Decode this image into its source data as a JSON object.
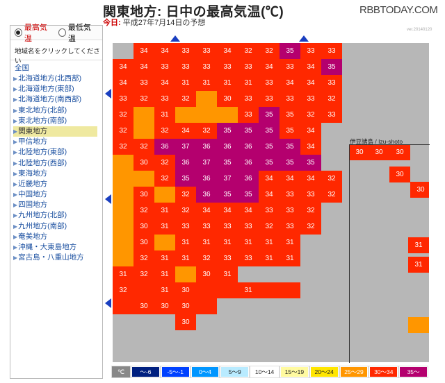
{
  "header": {
    "title": "関東地方: 日中の最高気温(℃)",
    "today_label": "今日:",
    "forecast_date": "平成27年7月14日の予想",
    "brand": "RBBTODAY.COM",
    "version": "ver.20140120"
  },
  "sidebar": {
    "radio_max": "最高気温",
    "radio_min": "最低気温",
    "instruction": "地域名をクリックしてください",
    "all_label": "全国",
    "items": [
      {
        "label": "北海道地方(北西部)"
      },
      {
        "label": "北海道地方(東部)"
      },
      {
        "label": "北海道地方(南西部)"
      },
      {
        "label": "東北地方(北部)"
      },
      {
        "label": "東北地方(南部)"
      },
      {
        "label": "関東地方"
      },
      {
        "label": "甲信地方"
      },
      {
        "label": "北陸地方(東部)"
      },
      {
        "label": "北陸地方(西部)"
      },
      {
        "label": "東海地方"
      },
      {
        "label": "近畿地方"
      },
      {
        "label": "中国地方"
      },
      {
        "label": "四国地方"
      },
      {
        "label": "九州地方(北部)"
      },
      {
        "label": "九州地方(南部)"
      },
      {
        "label": "奄美地方"
      },
      {
        "label": "沖縄・大東島地方"
      },
      {
        "label": "宮古島・八重山地方"
      }
    ],
    "selected_index": 5
  },
  "map": {
    "izu_label": "伊豆諸島 / Izu-shoto",
    "colors": {
      "c": "#ff2800",
      "v": "#b4006e",
      "o": "#ff9600"
    },
    "cells": [
      [
        "t,1",
        "34c"
      ],
      [
        "t,2",
        "34c"
      ],
      [
        "t,3",
        "33c"
      ],
      [
        "t,4",
        "33c"
      ],
      [
        "t,5",
        "34c"
      ],
      [
        "t,6",
        "32c"
      ],
      [
        "t,7",
        "32c"
      ],
      [
        "t,8",
        "35v"
      ],
      [
        "t,9",
        "33c"
      ],
      [
        "t,10",
        "33c"
      ],
      [
        "0,0",
        "34c"
      ],
      [
        "0,1",
        "34c"
      ],
      [
        "0,2",
        "33c"
      ],
      [
        "0,3",
        "33c"
      ],
      [
        "0,4",
        "33c"
      ],
      [
        "0,5",
        "33c"
      ],
      [
        "0,6",
        "33c"
      ],
      [
        "0,7",
        "34c"
      ],
      [
        "0,8",
        "33c"
      ],
      [
        "0,9",
        "34c"
      ],
      [
        "0,10",
        "35v"
      ],
      [
        "1,0",
        "34c"
      ],
      [
        "1,1",
        "33c"
      ],
      [
        "1,2",
        "34c"
      ],
      [
        "1,3",
        "31c"
      ],
      [
        "1,4",
        "31c"
      ],
      [
        "1,5",
        "31c"
      ],
      [
        "1,6",
        "31c"
      ],
      [
        "1,7",
        "33c"
      ],
      [
        "1,8",
        "34c"
      ],
      [
        "1,9",
        "34c"
      ],
      [
        "1,10",
        "33c"
      ],
      [
        "2,0",
        "33c"
      ],
      [
        "2,1",
        "32c"
      ],
      [
        "2,2",
        "33c"
      ],
      [
        "2,3",
        "32c"
      ],
      [
        "2,4",
        "o"
      ],
      [
        "2,5",
        "30c"
      ],
      [
        "2,6",
        "33c"
      ],
      [
        "2,7",
        "33c"
      ],
      [
        "2,8",
        "33c"
      ],
      [
        "2,9",
        "33c"
      ],
      [
        "2,10",
        "32c"
      ],
      [
        "3,0",
        "32c"
      ],
      [
        "3,1",
        "o"
      ],
      [
        "3,2",
        "31c"
      ],
      [
        "3,3",
        "o"
      ],
      [
        "3,4",
        "o"
      ],
      [
        "3,5",
        "o"
      ],
      [
        "3,6",
        "33c"
      ],
      [
        "3,7",
        "35v"
      ],
      [
        "3,8",
        "35c"
      ],
      [
        "3,9",
        "32c"
      ],
      [
        "3,10",
        "33c"
      ],
      [
        "4,0",
        "32c"
      ],
      [
        "4,1",
        "o"
      ],
      [
        "4,2",
        "32c"
      ],
      [
        "4,3",
        "34c"
      ],
      [
        "4,4",
        "32c"
      ],
      [
        "4,5",
        "35v"
      ],
      [
        "4,6",
        "35v"
      ],
      [
        "4,7",
        "35v"
      ],
      [
        "4,8",
        "35c"
      ],
      [
        "4,9",
        "34c"
      ],
      [
        "5,0",
        "32c"
      ],
      [
        "5,1",
        "32c"
      ],
      [
        "5,2",
        "36v"
      ],
      [
        "5,3",
        "37v"
      ],
      [
        "5,4",
        "36v"
      ],
      [
        "5,5",
        "36v"
      ],
      [
        "5,6",
        "36v"
      ],
      [
        "5,7",
        "35v"
      ],
      [
        "5,8",
        "35v"
      ],
      [
        "5,9",
        "34c"
      ],
      [
        "6,0",
        "o"
      ],
      [
        "6,1",
        "30c"
      ],
      [
        "6,2",
        "32c"
      ],
      [
        "6,3",
        "36v"
      ],
      [
        "6,4",
        "37v"
      ],
      [
        "6,5",
        "35v"
      ],
      [
        "6,6",
        "36v"
      ],
      [
        "6,7",
        "35v"
      ],
      [
        "6,8",
        "35v"
      ],
      [
        "6,9",
        "35v"
      ],
      [
        "7,0",
        "o"
      ],
      [
        "7,1",
        "o"
      ],
      [
        "7,2",
        "32c"
      ],
      [
        "7,3",
        "35v"
      ],
      [
        "7,4",
        "36v"
      ],
      [
        "7,5",
        "37v"
      ],
      [
        "7,6",
        "36v"
      ],
      [
        "7,7",
        "34c"
      ],
      [
        "7,8",
        "34c"
      ],
      [
        "7,9",
        "34c"
      ],
      [
        "7,10",
        "32c"
      ],
      [
        "8,0",
        "o"
      ],
      [
        "8,1",
        "30c"
      ],
      [
        "8,2",
        "o"
      ],
      [
        "8,3",
        "32c"
      ],
      [
        "8,4",
        "36v"
      ],
      [
        "8,5",
        "35v"
      ],
      [
        "8,6",
        "35v"
      ],
      [
        "8,7",
        "34c"
      ],
      [
        "8,8",
        "33c"
      ],
      [
        "8,9",
        "33c"
      ],
      [
        "8,10",
        "32c"
      ],
      [
        "9,0",
        "o"
      ],
      [
        "9,1",
        "32c"
      ],
      [
        "9,2",
        "31c"
      ],
      [
        "9,3",
        "32c"
      ],
      [
        "9,4",
        "34c"
      ],
      [
        "9,5",
        "34c"
      ],
      [
        "9,6",
        "34c"
      ],
      [
        "9,7",
        "33c"
      ],
      [
        "9,8",
        "33c"
      ],
      [
        "9,9",
        "32c"
      ],
      [
        "10,0",
        "o"
      ],
      [
        "10,1",
        "30c"
      ],
      [
        "10,2",
        "31c"
      ],
      [
        "10,3",
        "33c"
      ],
      [
        "10,4",
        "33c"
      ],
      [
        "10,5",
        "33c"
      ],
      [
        "10,6",
        "33c"
      ],
      [
        "10,7",
        "32c"
      ],
      [
        "10,8",
        "33c"
      ],
      [
        "10,9",
        "32c"
      ],
      [
        "11,0",
        "o"
      ],
      [
        "11,1",
        "30c"
      ],
      [
        "11,2",
        "o"
      ],
      [
        "11,3",
        "31c"
      ],
      [
        "11,4",
        "31c"
      ],
      [
        "11,5",
        "31c"
      ],
      [
        "11,6",
        "31c"
      ],
      [
        "11,7",
        "31c"
      ],
      [
        "11,8",
        "31c"
      ],
      [
        "12,0",
        "o"
      ],
      [
        "12,1",
        "32c"
      ],
      [
        "12,2",
        "31c"
      ],
      [
        "12,3",
        "31c"
      ],
      [
        "12,4",
        "32c"
      ],
      [
        "12,5",
        "33c"
      ],
      [
        "12,6",
        "33c"
      ],
      [
        "12,7",
        "31c"
      ],
      [
        "12,8",
        "31c"
      ],
      [
        "13,0",
        "31c"
      ],
      [
        "13,1",
        "32c"
      ],
      [
        "13,2",
        "31c"
      ],
      [
        "13,3",
        "o"
      ],
      [
        "13,4",
        "30c"
      ],
      [
        "13,5",
        "31c"
      ],
      [
        "14,0",
        "32c"
      ],
      [
        "14,1",
        "c"
      ],
      [
        "14,2",
        "31c"
      ],
      [
        "14,3",
        "30c"
      ],
      [
        "14,4",
        "c"
      ],
      [
        "14,5",
        "c"
      ],
      [
        "14,6",
        "31c"
      ],
      [
        "14,7",
        "c"
      ],
      [
        "14,8",
        "c"
      ],
      [
        "15,0",
        "c"
      ],
      [
        "15,1",
        "30c"
      ],
      [
        "15,2",
        "30c"
      ],
      [
        "15,3",
        "30c"
      ],
      [
        "15,4",
        "c"
      ],
      [
        "16,3",
        "30c"
      ],
      [
        "i,0",
        "30c"
      ],
      [
        "i,1",
        "30c"
      ],
      [
        "i,2",
        "30c"
      ],
      [
        "j,0",
        "30c"
      ],
      [
        "j,1",
        "30c"
      ],
      [
        "k,0",
        "31c"
      ],
      [
        "k2,0",
        "31c"
      ],
      [
        "m,0",
        "o"
      ]
    ]
  },
  "legend": {
    "unit": "℃",
    "items": [
      {
        "label": "〜-6",
        "bg": "#002080",
        "fg": "#fff"
      },
      {
        "label": "-5〜-1",
        "bg": "#0041ff",
        "fg": "#fff"
      },
      {
        "label": "0〜4",
        "bg": "#0096ff",
        "fg": "#fff"
      },
      {
        "label": "5〜9",
        "bg": "#b9ebff",
        "fg": "#222"
      },
      {
        "label": "10〜14",
        "bg": "#ffffff",
        "fg": "#222"
      },
      {
        "label": "15〜19",
        "bg": "#fffaa0",
        "fg": "#222"
      },
      {
        "label": "20〜24",
        "bg": "#ffe600",
        "fg": "#222"
      },
      {
        "label": "25〜29",
        "bg": "#ff9600",
        "fg": "#fff"
      },
      {
        "label": "30〜34",
        "bg": "#ff2800",
        "fg": "#fff"
      },
      {
        "label": "35〜",
        "bg": "#b4006e",
        "fg": "#fff"
      }
    ]
  }
}
